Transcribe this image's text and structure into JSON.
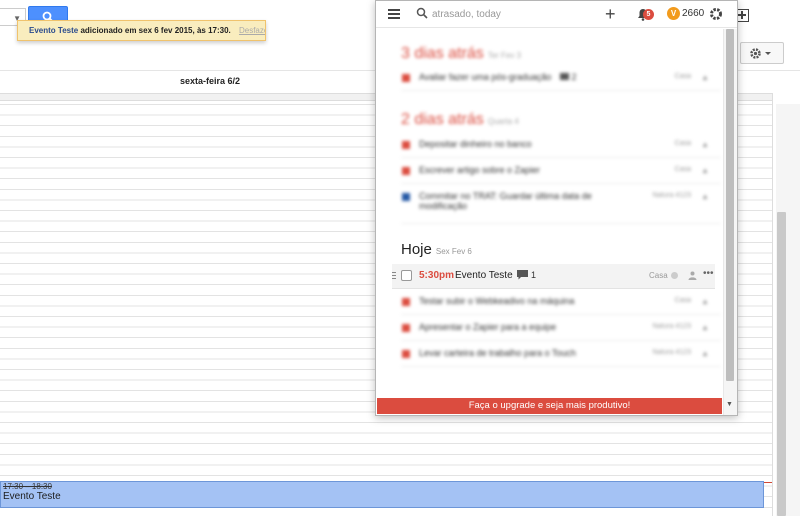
{
  "calendar": {
    "notice": {
      "event_name": "Evento Teste",
      "message": "adicionado em sex 6 fev 2015, às 17:30.",
      "undo_label": "Desfazer"
    },
    "day_header": "sexta-feira 6/2",
    "event": {
      "time": "17:30 – 18:30",
      "title": "Evento Teste"
    }
  },
  "popup": {
    "search_placeholder": "atrasado, today",
    "notifications_count": "5",
    "karma_points": "2660",
    "sections": [
      {
        "title": "3 dias atrás",
        "subtitle": "Ter Fev 3",
        "tasks": [
          {
            "text": "Avaliar fazer uma pós-graduação",
            "comments": "2",
            "project": "Casa",
            "color": "#db4c3f"
          }
        ]
      },
      {
        "title": "2 dias atrás",
        "subtitle": "Quarta 4",
        "tasks": [
          {
            "text": "Depositar dinheiro no banco",
            "project": "Casa",
            "color": "#db4c3f"
          },
          {
            "text": "Escrever artigo sobre o Zapier",
            "project": "Casa",
            "color": "#db4c3f"
          },
          {
            "text": "Commitar no TRAT: Guardar última data de",
            "text2": "modificação",
            "project": "Natura 4123",
            "color": "#2458a6"
          }
        ]
      }
    ],
    "today": {
      "title": "Hoje",
      "subtitle": "Sex Fev 6",
      "active_task": {
        "time": "5:30pm",
        "name": "Evento Teste",
        "comments": "1",
        "project": "Casa"
      },
      "tasks": [
        {
          "text": "Testar subir o Webkeadivo na máquina",
          "project": "Casa",
          "color": "#db4c3f"
        },
        {
          "text": "Apresentar o Zapier para a equipe",
          "project": "Natura 4123",
          "color": "#db4c3f"
        },
        {
          "text": "Levar carteira de trabalho para o Touch",
          "project": "Natura 4123",
          "color": "#db4c3f"
        }
      ]
    },
    "upgrade_label": "Faça o upgrade e seja mais produtivo!"
  },
  "colors": {
    "accent_red": "#db4c3f",
    "google_blue": "#4d90fe",
    "event_blue": "#a4c2f4",
    "notice_yellow": "#f9edbe",
    "karma_orange": "#f29b1d"
  }
}
